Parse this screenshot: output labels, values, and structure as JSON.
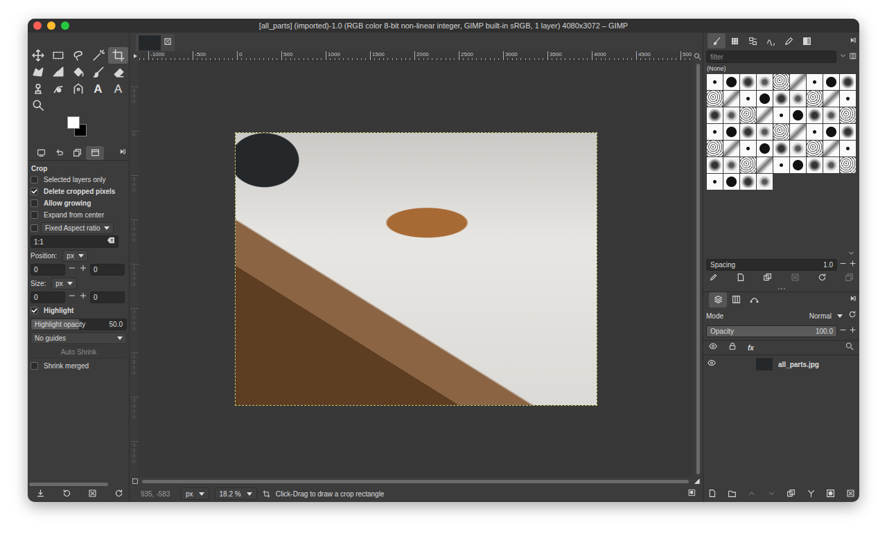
{
  "window": {
    "title": "[all_parts] (imported)-1.0 (RGB color 8-bit non-linear integer, GIMP built-in sRGB, 1 layer) 4080x3072 – GIMP"
  },
  "toolbox": {
    "tools": [
      {
        "selected": false
      },
      {
        "selected": false
      },
      {
        "selected": false
      },
      {
        "selected": false
      },
      {
        "selected": true
      },
      {
        "selected": false
      },
      {
        "selected": false
      },
      {
        "selected": false
      },
      {
        "selected": false
      },
      {
        "selected": false
      },
      {
        "selected": false
      },
      {
        "selected": false
      },
      {
        "selected": false
      },
      {
        "selected": false,
        "glyph": "A"
      },
      {
        "selected": false,
        "glyph": "A"
      },
      {
        "selected": false
      }
    ]
  },
  "option_tabs": [
    {
      "selected": false
    },
    {
      "selected": false
    },
    {
      "selected": false
    },
    {
      "selected": true
    }
  ],
  "tool_options": {
    "title": "Crop",
    "rows": [
      {
        "kind": "check",
        "label": "Selected layers only",
        "checked": false,
        "emphasized": false
      },
      {
        "kind": "check",
        "label": "Delete cropped pixels",
        "checked": true,
        "emphasized": true
      },
      {
        "kind": "check",
        "label": "Allow growing",
        "checked": false,
        "emphasized": true
      },
      {
        "kind": "check",
        "label": "Expand from center",
        "checked": false,
        "emphasized": false
      },
      {
        "kind": "checkselect",
        "label": "Fixed Aspect ratio",
        "checked": false
      },
      {
        "kind": "entry",
        "value": "1:1"
      },
      {
        "kind": "unit",
        "label": "Position:",
        "unit": "px"
      },
      {
        "kind": "pair",
        "values": [
          "0",
          "0"
        ]
      },
      {
        "kind": "unit",
        "label": "Size:",
        "unit": "px"
      },
      {
        "kind": "pair",
        "values": [
          "0",
          "0"
        ]
      },
      {
        "kind": "check",
        "label": "Highlight",
        "checked": true,
        "emphasized": true
      },
      {
        "kind": "slider",
        "label": "Highlight opacity",
        "value": "50.0",
        "level": 0.5
      },
      {
        "kind": "select",
        "label": "No guides"
      },
      {
        "kind": "button",
        "label": "Auto Shrink",
        "disabled": true
      },
      {
        "kind": "check",
        "label": "Shrink merged",
        "checked": false,
        "emphasized": false
      }
    ]
  },
  "image_tabs": [
    {
      "selected": true
    }
  ],
  "rulers": {
    "horizontal": [
      "-1000",
      "-500",
      "0",
      "500",
      "1000",
      "1500",
      "2000",
      "2500",
      "3000",
      "3500",
      "4000",
      "4500",
      "500"
    ],
    "vertical": [
      "500",
      "0",
      "500",
      "1000",
      "1500",
      "2000",
      "2500",
      "3000",
      "3500"
    ]
  },
  "status_bar": {
    "coords": "935, -583",
    "unit": "px",
    "zoom": "18.2 %",
    "message": "Click-Drag to draw a crop rectangle"
  },
  "dock": {
    "tabs": [
      {
        "selected": true
      },
      {
        "selected": false
      },
      {
        "selected": false
      },
      {
        "selected": false
      },
      {
        "selected": false
      },
      {
        "selected": false
      }
    ],
    "filter": {
      "placeholder": "filter"
    },
    "brush_name": "(None)",
    "spacing": {
      "label": "Spacing",
      "value": "1.0",
      "level": 0
    },
    "brush_actions": [
      {
        "disabled": false
      },
      {
        "disabled": false
      },
      {
        "disabled": false
      },
      {
        "disabled": true
      },
      {
        "disabled": false
      },
      {
        "disabled": true
      }
    ],
    "layer_tabs": [
      {
        "selected": true
      },
      {
        "selected": false
      },
      {
        "selected": false
      }
    ],
    "mode": {
      "label": "Mode",
      "value": "Normal"
    },
    "opacity": {
      "label": "Opacity",
      "value": "100.0",
      "level": 1
    },
    "effects_label": "fx",
    "layers": [
      {
        "name": "all_parts.jpg",
        "visible": true
      }
    ],
    "layer_actions": [
      {
        "disabled": false
      },
      {
        "disabled": false
      },
      {
        "disabled": true
      },
      {
        "disabled": true
      },
      {
        "disabled": false
      },
      {
        "disabled": false
      },
      {
        "disabled": false
      },
      {
        "disabled": false
      }
    ]
  }
}
